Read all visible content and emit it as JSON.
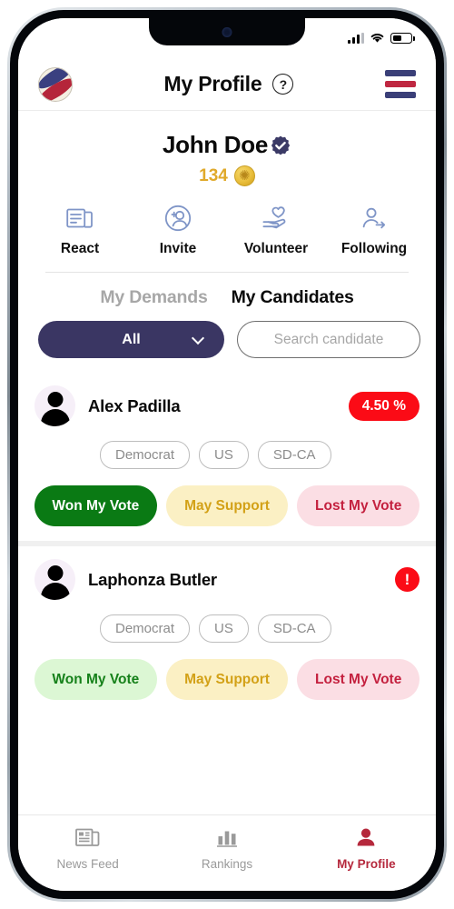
{
  "status_bar": {
    "signal_icon": "cellular-signal-icon",
    "wifi_icon": "wifi-icon",
    "battery_icon": "battery-icon"
  },
  "header": {
    "logo_icon": "app-logo-icon",
    "title": "My Profile",
    "help_label": "?",
    "menu_icon": "hamburger-menu-icon",
    "colors": {
      "navy": "#3a3f78",
      "red": "#bf2741"
    }
  },
  "profile": {
    "name": "John Doe",
    "verified_icon": "verified-badge-icon",
    "points": "134",
    "coin_icon": "coin-icon"
  },
  "actions": [
    {
      "label": "React",
      "icon": "newspaper-icon"
    },
    {
      "label": "Invite",
      "icon": "person-add-icon"
    },
    {
      "label": "Volunteer",
      "icon": "hand-heart-icon"
    },
    {
      "label": "Following",
      "icon": "person-arrow-icon"
    }
  ],
  "tabs": [
    {
      "label": "My Demands",
      "active": false
    },
    {
      "label": "My Candidates",
      "active": true
    }
  ],
  "filter": {
    "selected": "All",
    "chevron_icon": "chevron-down-icon"
  },
  "search": {
    "placeholder": "Search candidate",
    "value": ""
  },
  "candidates": [
    {
      "name": "Alex Padilla",
      "avatar_icon": "person-avatar-icon",
      "badge_type": "percent",
      "badge_text": "4.50 %",
      "badge_color": "#fb0b16",
      "tags": [
        "Democrat",
        "US",
        "SD-CA"
      ],
      "votes": [
        {
          "label": "Won My Vote",
          "state": "selected"
        },
        {
          "label": "May Support",
          "state": "normal"
        },
        {
          "label": "Lost My Vote",
          "state": "normal"
        }
      ]
    },
    {
      "name": "Laphonza Butler",
      "avatar_icon": "person-avatar-icon",
      "badge_type": "alert",
      "badge_text": "!",
      "badge_color": "#fb0b16",
      "tags": [
        "Democrat",
        "US",
        "SD-CA"
      ],
      "votes": [
        {
          "label": "Won My Vote",
          "state": "normal"
        },
        {
          "label": "May Support",
          "state": "normal"
        },
        {
          "label": "Lost My Vote",
          "state": "normal"
        }
      ]
    }
  ],
  "bottom_nav": [
    {
      "label": "News Feed",
      "icon": "newspaper-icon",
      "active": false
    },
    {
      "label": "Rankings",
      "icon": "bar-chart-icon",
      "active": false
    },
    {
      "label": "My Profile",
      "icon": "person-icon",
      "active": true
    }
  ]
}
